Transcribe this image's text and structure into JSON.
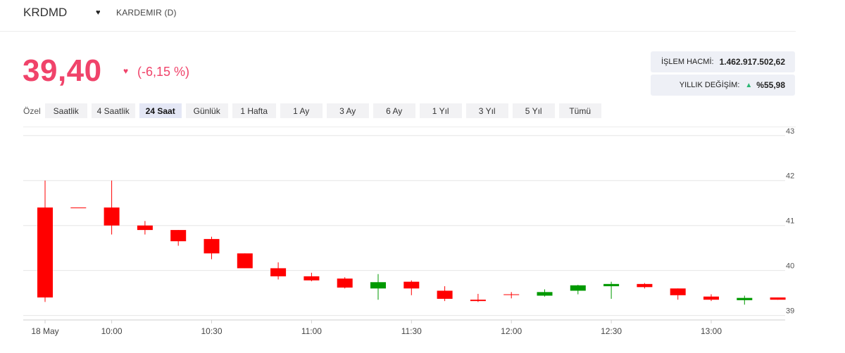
{
  "header": {
    "symbol": "KRDMD",
    "company": "KARDEMIR (D)"
  },
  "quote": {
    "price": "39,40",
    "change": "(-6,15 %)"
  },
  "stats": {
    "volume_label": "İŞLEM HACMİ:",
    "volume_value": "1.462.917.502,62",
    "yearly_label": "YILLIK DEĞİŞİM:",
    "yearly_value": "%55,98"
  },
  "range_prefix": "Özel",
  "ranges": [
    "Saatlik",
    "4 Saatlik",
    "24 Saat",
    "Günlük",
    "1 Hafta",
    "1 Ay",
    "3 Ay",
    "6 Ay",
    "1 Yıl",
    "3 Yıl",
    "5 Yıl",
    "Tümü"
  ],
  "active_range": "24 Saat",
  "colors": {
    "up": "#009900",
    "down": "#ff0000",
    "accent": "#f0436a"
  },
  "chart_data": {
    "type": "candlestick",
    "ylim": [
      38.9,
      43.2
    ],
    "yticks": [
      39,
      40,
      41,
      42,
      43
    ],
    "xtick_labels": [
      {
        "label": "18 May",
        "idx": 0
      },
      {
        "label": "10:00",
        "idx": 2
      },
      {
        "label": "10:30",
        "idx": 5
      },
      {
        "label": "11:00",
        "idx": 8
      },
      {
        "label": "11:30",
        "idx": 11
      },
      {
        "label": "12:00",
        "idx": 14
      },
      {
        "label": "12:30",
        "idx": 17
      },
      {
        "label": "13:00",
        "idx": 20
      }
    ],
    "candles": [
      {
        "o": 41.4,
        "h": 42.0,
        "l": 39.3,
        "c": 39.4
      },
      {
        "o": 41.4,
        "h": 41.4,
        "l": 41.4,
        "c": 41.4
      },
      {
        "o": 41.4,
        "h": 42.0,
        "l": 40.8,
        "c": 41.0
      },
      {
        "o": 41.0,
        "h": 41.1,
        "l": 40.8,
        "c": 40.9
      },
      {
        "o": 40.9,
        "h": 40.9,
        "l": 40.55,
        "c": 40.65
      },
      {
        "o": 40.7,
        "h": 40.75,
        "l": 40.25,
        "c": 40.38
      },
      {
        "o": 40.38,
        "h": 40.38,
        "l": 40.05,
        "c": 40.05
      },
      {
        "o": 40.05,
        "h": 40.18,
        "l": 39.8,
        "c": 39.87
      },
      {
        "o": 39.87,
        "h": 39.95,
        "l": 39.76,
        "c": 39.78
      },
      {
        "o": 39.82,
        "h": 39.85,
        "l": 39.6,
        "c": 39.62
      },
      {
        "o": 39.6,
        "h": 39.92,
        "l": 39.35,
        "c": 39.74
      },
      {
        "o": 39.75,
        "h": 39.78,
        "l": 39.45,
        "c": 39.6
      },
      {
        "o": 39.55,
        "h": 39.65,
        "l": 39.32,
        "c": 39.37
      },
      {
        "o": 39.35,
        "h": 39.48,
        "l": 39.3,
        "c": 39.32
      },
      {
        "o": 39.47,
        "h": 39.52,
        "l": 39.38,
        "c": 39.46
      },
      {
        "o": 39.44,
        "h": 39.58,
        "l": 39.42,
        "c": 39.52
      },
      {
        "o": 39.55,
        "h": 39.68,
        "l": 39.47,
        "c": 39.67
      },
      {
        "o": 39.65,
        "h": 39.75,
        "l": 39.37,
        "c": 39.7
      },
      {
        "o": 39.7,
        "h": 39.72,
        "l": 39.6,
        "c": 39.63
      },
      {
        "o": 39.6,
        "h": 39.6,
        "l": 39.35,
        "c": 39.45
      },
      {
        "o": 39.42,
        "h": 39.47,
        "l": 39.32,
        "c": 39.35
      },
      {
        "o": 39.34,
        "h": 39.44,
        "l": 39.24,
        "c": 39.39
      },
      {
        "o": 39.4,
        "h": 39.4,
        "l": 39.35,
        "c": 39.35
      }
    ]
  }
}
